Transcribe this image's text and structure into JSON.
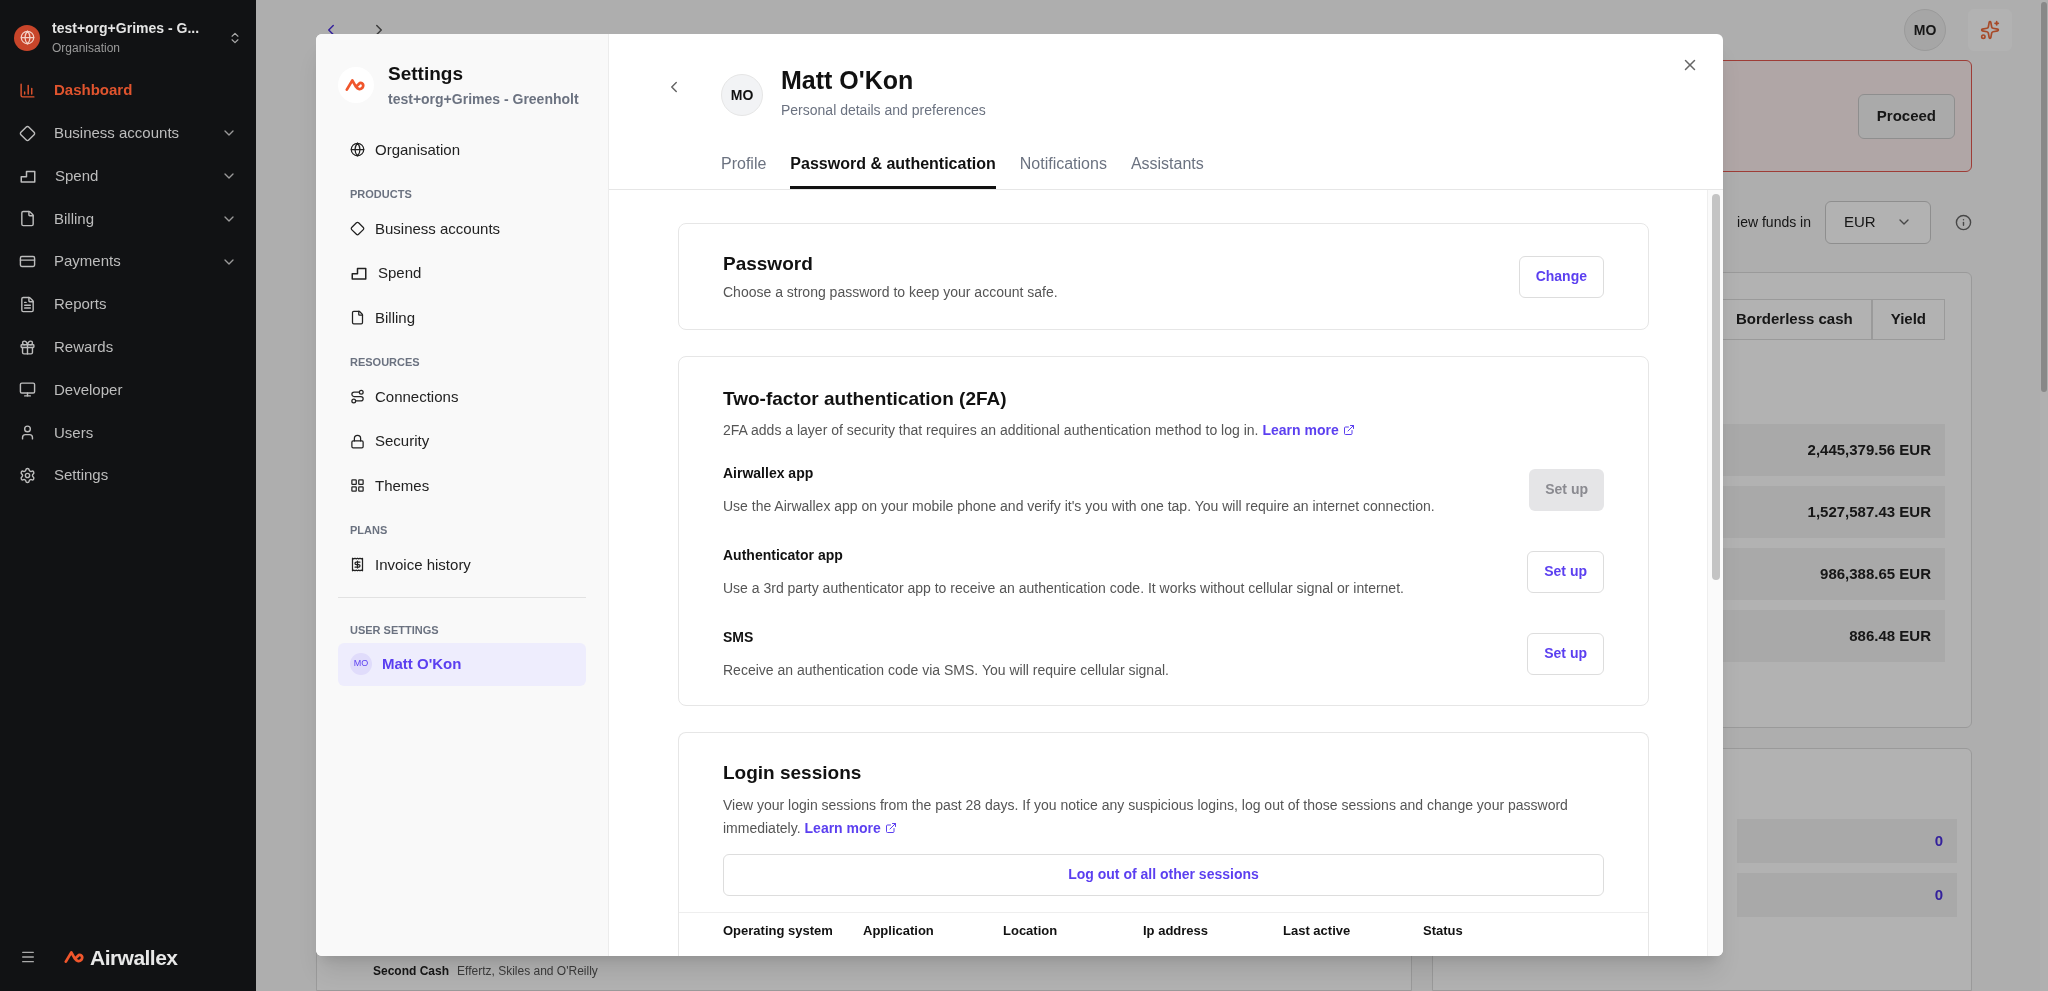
{
  "app_sidebar": {
    "org": {
      "name": "test+org+Grimes - G...",
      "subtitle": "Organisation"
    },
    "items": [
      {
        "label": "Dashboard",
        "selected": true,
        "expandable": false
      },
      {
        "label": "Business accounts",
        "selected": false,
        "expandable": true
      },
      {
        "label": "Spend",
        "selected": false,
        "expandable": true
      },
      {
        "label": "Billing",
        "selected": false,
        "expandable": true
      },
      {
        "label": "Payments",
        "selected": false,
        "expandable": true
      },
      {
        "label": "Reports",
        "selected": false,
        "expandable": false
      },
      {
        "label": "Rewards",
        "selected": false,
        "expandable": false
      },
      {
        "label": "Developer",
        "selected": false,
        "expandable": false
      },
      {
        "label": "Users",
        "selected": false,
        "expandable": false
      },
      {
        "label": "Settings",
        "selected": false,
        "expandable": false
      }
    ],
    "brand": "Airwallex"
  },
  "background": {
    "avatar": "MO",
    "proceed_button": "Proceed",
    "funds_label": "iew funds in",
    "currency": "EUR",
    "tabs": [
      {
        "label": "Borderless cash",
        "selected": false
      },
      {
        "label": "Yield",
        "selected": false
      }
    ],
    "balances": [
      "2,445,379.56 EUR",
      "1,527,587.43 EUR",
      "986,388.65 EUR",
      "886.48 EUR"
    ],
    "counts": [
      "0",
      "0"
    ],
    "footer_row": {
      "name": "Second Cash",
      "detail": "Effertz, Skiles and O'Reilly"
    }
  },
  "settings": {
    "title": "Settings",
    "org": "test+org+Grimes - Greenholt",
    "nav": [
      {
        "kind": "item",
        "label": "Organisation",
        "selected": false
      },
      {
        "kind": "heading",
        "label": "PRODUCTS"
      },
      {
        "kind": "item",
        "label": "Business accounts",
        "selected": false
      },
      {
        "kind": "item",
        "label": "Spend",
        "selected": false
      },
      {
        "kind": "item",
        "label": "Billing",
        "selected": false
      },
      {
        "kind": "heading",
        "label": "RESOURCES"
      },
      {
        "kind": "item",
        "label": "Connections",
        "selected": false
      },
      {
        "kind": "item",
        "label": "Security",
        "selected": false
      },
      {
        "kind": "item",
        "label": "Themes",
        "selected": false
      },
      {
        "kind": "heading",
        "label": "PLANS"
      },
      {
        "kind": "item",
        "label": "Invoice history",
        "selected": false
      },
      {
        "kind": "divider"
      },
      {
        "kind": "heading",
        "label": "USER SETTINGS"
      },
      {
        "kind": "user",
        "avatar": "MO",
        "label": "Matt O'Kon",
        "selected": true
      }
    ],
    "profile": {
      "avatar": "MO",
      "name": "Matt O'Kon",
      "subtitle": "Personal details and preferences"
    },
    "tabs": [
      {
        "label": "Profile",
        "selected": false
      },
      {
        "label": "Password & authentication",
        "selected": true
      },
      {
        "label": "Notifications",
        "selected": false
      },
      {
        "label": "Assistants",
        "selected": false
      }
    ],
    "password": {
      "title": "Password",
      "description": "Choose a strong password to keep your account safe.",
      "button": "Change"
    },
    "two_factor": {
      "title": "Two-factor authentication (2FA)",
      "description": "2FA adds a layer of security that requires an additional authentication method to log in.",
      "link": "Learn more",
      "methods": [
        {
          "name": "Airwallex app",
          "description": "Use the Airwallex app on your mobile phone and verify it's you with one tap. You will require an internet connection.",
          "button": "Set up",
          "disabled": true
        },
        {
          "name": "Authenticator app",
          "description": "Use a 3rd party authenticator app to receive an authentication code. It works without cellular signal or internet.",
          "button": "Set up",
          "disabled": false
        },
        {
          "name": "SMS",
          "description": "Receive an authentication code via SMS. You will require cellular signal.",
          "button": "Set up",
          "disabled": false
        }
      ]
    },
    "login_sessions": {
      "title": "Login sessions",
      "description": "View your login sessions from the past 28 days. If you notice any suspicious logins, log out of those sessions and change your password immediately.",
      "link": "Learn more",
      "button": "Log out of all other sessions",
      "columns": [
        "Operating system",
        "Application",
        "Location",
        "Ip address",
        "Last active",
        "Status"
      ]
    }
  }
}
